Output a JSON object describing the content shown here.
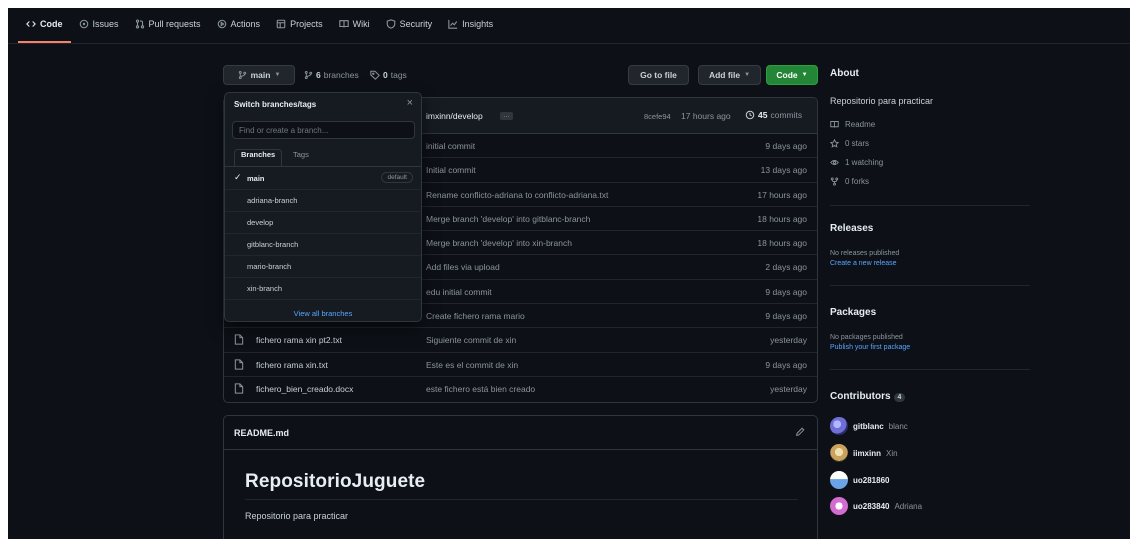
{
  "nav": {
    "tabs": [
      {
        "label": "Code",
        "icon": "code-icon",
        "active": true
      },
      {
        "label": "Issues",
        "icon": "issue-icon"
      },
      {
        "label": "Pull requests",
        "icon": "pull-request-icon"
      },
      {
        "label": "Actions",
        "icon": "play-icon"
      },
      {
        "label": "Projects",
        "icon": "table-icon"
      },
      {
        "label": "Wiki",
        "icon": "book-icon"
      },
      {
        "label": "Security",
        "icon": "shield-icon"
      },
      {
        "label": "Insights",
        "icon": "graph-icon"
      }
    ]
  },
  "branchbar": {
    "branch": "main",
    "branches_count": "6",
    "branches_label": "branches",
    "tags_count": "0",
    "tags_label": "tags",
    "goto_file": "Go to file",
    "add_file": "Add file",
    "code": "Code"
  },
  "commit": {
    "author_branch": "imxinn/develop",
    "ellipsis": "…",
    "hash": "8cefe94",
    "time": "17 hours ago",
    "commits_count": "45",
    "commits_label": "commits"
  },
  "files": [
    {
      "name": "",
      "message": "initial commit",
      "time": "9 days ago"
    },
    {
      "name": "",
      "message": "Initial commit",
      "time": "13 days ago"
    },
    {
      "name": "",
      "message": "Rename conflicto-adriana to conflicto-adriana.txt",
      "time": "17 hours ago"
    },
    {
      "name": "",
      "message": "Merge branch 'develop' into gitblanc-branch",
      "time": "18 hours ago"
    },
    {
      "name": "",
      "message": "Merge branch 'develop' into xin-branch",
      "time": "18 hours ago"
    },
    {
      "name": "",
      "message": "Add files via upload",
      "time": "2 days ago"
    },
    {
      "name": "",
      "message": "edu initial commit",
      "time": "9 days ago"
    },
    {
      "name": "",
      "message": "Create fichero rama mario",
      "time": "9 days ago"
    },
    {
      "name": "fichero rama xin pt2.txt",
      "message": "Siguiente commit de xin",
      "time": "yesterday"
    },
    {
      "name": "fichero rama xin.txt",
      "message": "Este es el commit de xin",
      "time": "9 days ago"
    },
    {
      "name": "fichero_bien_creado.docx",
      "message": "este fichero está bien creado",
      "time": "yesterday"
    }
  ],
  "dropdown": {
    "title": "Switch branches/tags",
    "close": "×",
    "placeholder": "Find or create a branch...",
    "tab_branches": "Branches",
    "tab_tags": "Tags",
    "default_badge": "default",
    "branches": [
      "main",
      "adriana-branch",
      "develop",
      "gitblanc-branch",
      "mario-branch",
      "xin-branch"
    ],
    "view_all": "View all branches"
  },
  "readme": {
    "filename": "README.md",
    "heading": "RepositorioJuguete",
    "body": "Repositorio para practicar"
  },
  "about": {
    "title": "About",
    "description": "Repositorio para practicar",
    "readme": "Readme",
    "stars": "0 stars",
    "watching": "1 watching",
    "forks": "0 forks"
  },
  "releases": {
    "title": "Releases",
    "none": "No releases published",
    "create": "Create a new release"
  },
  "packages": {
    "title": "Packages",
    "none": "No packages published",
    "publish": "Publish your first package"
  },
  "contributors": {
    "title": "Contributors",
    "count": "4",
    "list": [
      {
        "login": "gitblanc",
        "name": "blanc",
        "color": "#6f6fd6"
      },
      {
        "login": "iimxinn",
        "name": "Xin",
        "color": "#c9a35c"
      },
      {
        "login": "uo281860",
        "name": "",
        "color": "#6aa3e8"
      },
      {
        "login": "uo283840",
        "name": "Adriana",
        "color": "#d46bd1"
      }
    ]
  }
}
